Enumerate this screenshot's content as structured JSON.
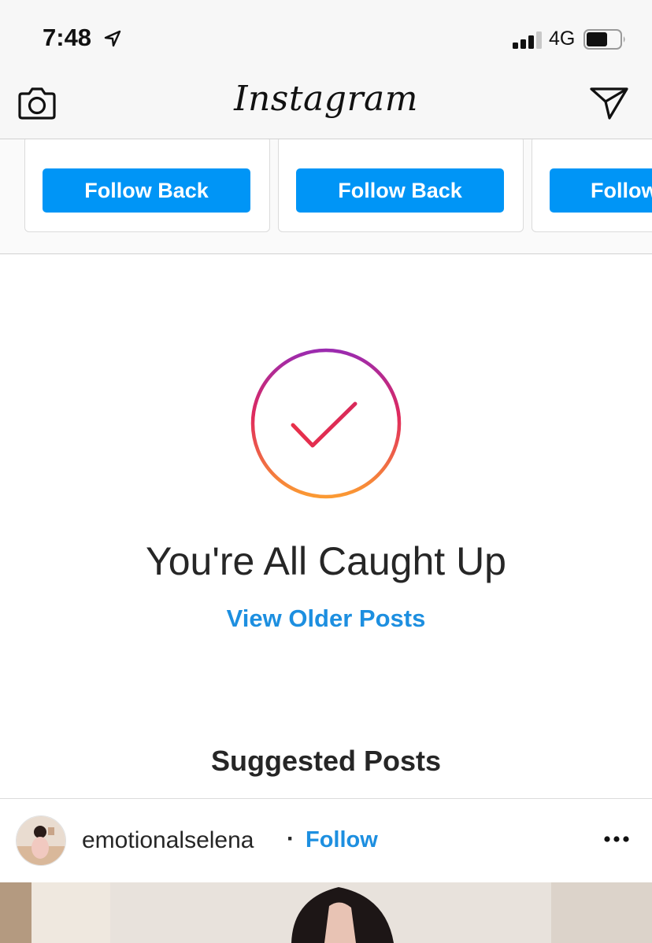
{
  "status_bar": {
    "time": "7:48",
    "network": "4G",
    "icons": [
      "location-arrow-icon",
      "signal-icon",
      "battery-icon"
    ]
  },
  "nav": {
    "logo": "Instagram",
    "left_icon": "camera-icon",
    "right_icon": "direct-message-icon"
  },
  "suggestions": {
    "cards": [
      {
        "button_label": "Follow Back"
      },
      {
        "button_label": "Follow Back"
      },
      {
        "button_label": "Follow Back"
      }
    ]
  },
  "feed_end": {
    "title": "You're All Caught Up",
    "link": "View Older Posts",
    "suggested_heading": "Suggested Posts"
  },
  "post": {
    "username": "emotionalselena",
    "separator": "·",
    "follow_label": "Follow",
    "menu_icon": "more-options-icon"
  },
  "colors": {
    "primary_button": "#0095f6",
    "link": "#1d8fe0",
    "gradient": [
      "#8a3ab9",
      "#e1306c",
      "#fd8d32"
    ]
  }
}
